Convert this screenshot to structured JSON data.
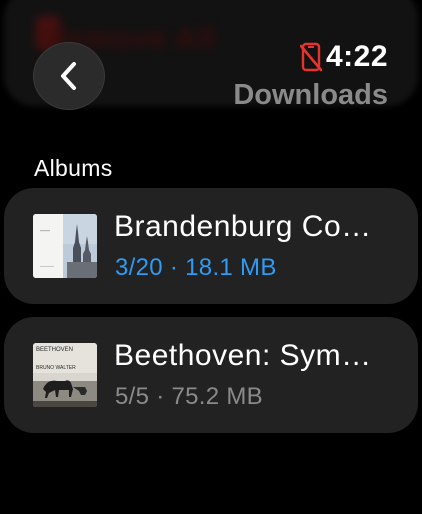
{
  "status": {
    "time": "4:22",
    "connection_icon": "phone-disconnected-icon",
    "connection_color": "#e5332f"
  },
  "header": {
    "title": "Downloads",
    "back_icon": "chevron-left-icon",
    "obscured_item": "Remove All"
  },
  "albums_section": {
    "label": "Albums",
    "items": [
      {
        "title": "Brandenburg Concertos",
        "progress": "3/20",
        "separator": "·",
        "size": "18.1 MB",
        "meta_color": "#2f9bf5",
        "status": "downloading"
      },
      {
        "title": "Beethoven: Symphony",
        "progress": "5/5",
        "separator": "·",
        "size": "75.2 MB",
        "meta_color": "#8a8a8a",
        "status": "downloaded",
        "art_caption_top": "BEETHOVEN",
        "art_caption_bottom": "BRUNO WALTER"
      }
    ]
  },
  "colors": {
    "background": "#000000",
    "row_background": "#222222",
    "accent": "#2f9bf5"
  }
}
